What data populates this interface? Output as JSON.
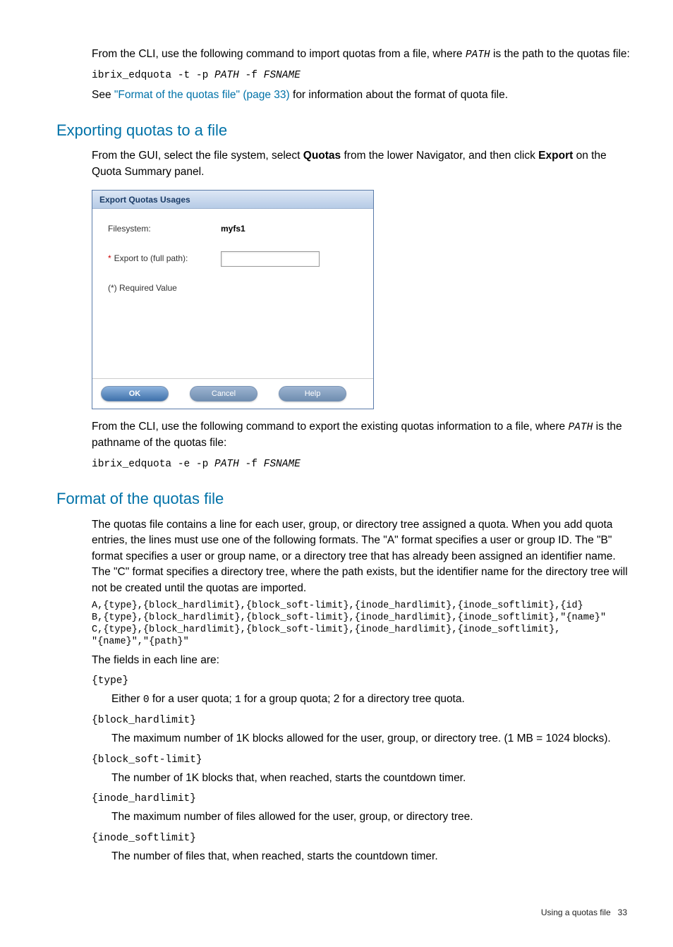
{
  "para1_pre": "From the CLI, use the following command to import quotas from a file, where ",
  "para1_path": "PATH",
  "para1_post": " is the path to the quotas file:",
  "cmd1_pre": "ibrix_edquota -t -p ",
  "cmd1_path": "PATH",
  "cmd1_mid": " -f ",
  "cmd1_fs": "FSNAME",
  "see_pre": "See ",
  "see_link": "\"Format of the quotas file\" (page 33)",
  "see_post": " for information about the format of quota file.",
  "h1": "Exporting quotas to a file",
  "p2_pre": "From the GUI, select the file system, select ",
  "p2_b1": "Quotas",
  "p2_mid": " from the lower Navigator, and then click ",
  "p2_b2": "Export",
  "p2_post": " on the Quota Summary panel.",
  "dialog": {
    "title": "Export Quotas Usages",
    "fs_label": "Filesystem:",
    "fs_value": "myfs1",
    "export_label": "Export to (full path):",
    "required": "(*) Required Value",
    "ok": "OK",
    "cancel": "Cancel",
    "help": "Help"
  },
  "p3_pre": "From the CLI, use the following command to export the existing quotas information to a file, where ",
  "p3_path": "PATH",
  "p3_post": " is the pathname of the quotas file:",
  "cmd2_pre": "ibrix_edquota -e -p ",
  "cmd2_path": "PATH",
  "cmd2_mid": " -f ",
  "cmd2_fs": "FSNAME",
  "h2": "Format of the quotas file",
  "p4": "The quotas file contains a line for each user, group, or directory tree assigned a quota. When you add quota entries, the lines must use one of the following formats. The \"A\" format specifies a user or group ID. The \"B\" format specifies a user or group name, or a directory tree that has already been assigned an identifier name. The \"C\" format specifies a directory tree, where the path exists, but the identifier name for the directory tree will not be created until the quotas are imported.",
  "fmt": "A,{type},{block_hardlimit},{block_soft-limit},{inode_hardlimit},{inode_softlimit},{id}\nB,{type},{block_hardlimit},{block_soft-limit},{inode_hardlimit},{inode_softlimit},\"{name}\"\nC,{type},{block_hardlimit},{block_soft-limit},{inode_hardlimit},{inode_softlimit},\n\"{name}\",\"{path}\"",
  "p5": "The fields in each line are:",
  "fields": {
    "type": {
      "t": "{type}",
      "d_pre": "Either ",
      "d_0": "0",
      "d_mid1": " for a user quota; ",
      "d_1": "1",
      "d_mid2": " for a group quota; 2 for a directory tree quota."
    },
    "bhl": {
      "t": "{block_hardlimit}",
      "d": "The maximum number of 1K blocks allowed for the user, group, or directory tree. (1 MB = 1024 blocks)."
    },
    "bsl": {
      "t": "{block_soft-limit}",
      "d": "The number of 1K blocks that, when reached, starts the countdown timer."
    },
    "ihl": {
      "t": "{inode_hardlimit}",
      "d": "The maximum number of files allowed for the user, group, or directory tree."
    },
    "isl": {
      "t": "{inode_softlimit}",
      "d": "The number of files that, when reached, starts the countdown timer."
    }
  },
  "footer_text": "Using a quotas file",
  "footer_page": "33"
}
